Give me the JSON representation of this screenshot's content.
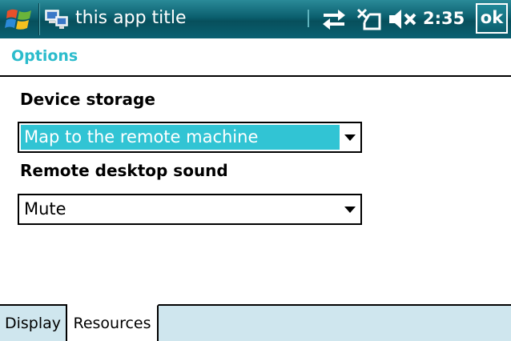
{
  "titlebar": {
    "app_title": "this app title",
    "clock": "2:35",
    "ok_label": "ok",
    "icons": [
      "windows-start-icon",
      "remote-desktop-icon",
      "sync-icon",
      "no-signal-icon",
      "mute-icon"
    ]
  },
  "page": {
    "title": "Options"
  },
  "form": {
    "device_storage": {
      "label": "Device storage",
      "value": "Map to the remote machine"
    },
    "remote_sound": {
      "label": "Remote desktop sound",
      "value": "Mute"
    }
  },
  "tabs": [
    {
      "label": "Display",
      "active": false
    },
    {
      "label": "Resources",
      "active": true
    }
  ],
  "colors": {
    "titlebar": "#0b5f6e",
    "accent": "#2cbccc",
    "selection": "#31c4d4",
    "tabbar": "#cfe6ee"
  }
}
